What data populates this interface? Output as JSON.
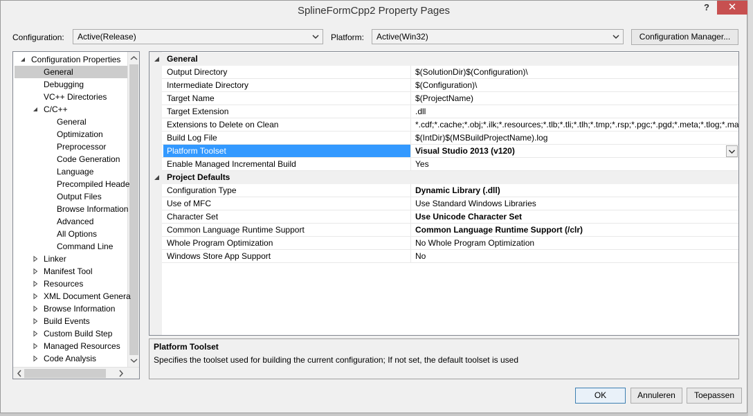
{
  "window": {
    "title": "SplineFormCpp2 Property Pages",
    "help": "?",
    "close": "✕"
  },
  "top": {
    "configuration_label": "Configuration:",
    "configuration_value": "Active(Release)",
    "platform_label": "Platform:",
    "platform_value": "Active(Win32)",
    "config_manager": "Configuration Manager..."
  },
  "tree": [
    {
      "label": "Configuration Properties",
      "level": 0,
      "toggle": "expanded"
    },
    {
      "label": "General",
      "level": 1,
      "selected": true
    },
    {
      "label": "Debugging",
      "level": 1
    },
    {
      "label": "VC++ Directories",
      "level": 1
    },
    {
      "label": "C/C++",
      "level": 1,
      "toggle": "expanded"
    },
    {
      "label": "General",
      "level": 2
    },
    {
      "label": "Optimization",
      "level": 2
    },
    {
      "label": "Preprocessor",
      "level": 2
    },
    {
      "label": "Code Generation",
      "level": 2
    },
    {
      "label": "Language",
      "level": 2
    },
    {
      "label": "Precompiled Heade",
      "level": 2
    },
    {
      "label": "Output Files",
      "level": 2
    },
    {
      "label": "Browse Information",
      "level": 2
    },
    {
      "label": "Advanced",
      "level": 2
    },
    {
      "label": "All Options",
      "level": 2
    },
    {
      "label": "Command Line",
      "level": 2
    },
    {
      "label": "Linker",
      "level": 1,
      "toggle": "collapsed"
    },
    {
      "label": "Manifest Tool",
      "level": 1,
      "toggle": "collapsed"
    },
    {
      "label": "Resources",
      "level": 1,
      "toggle": "collapsed"
    },
    {
      "label": "XML Document Genera",
      "level": 1,
      "toggle": "collapsed"
    },
    {
      "label": "Browse Information",
      "level": 1,
      "toggle": "collapsed"
    },
    {
      "label": "Build Events",
      "level": 1,
      "toggle": "collapsed"
    },
    {
      "label": "Custom Build Step",
      "level": 1,
      "toggle": "collapsed"
    },
    {
      "label": "Managed Resources",
      "level": 1,
      "toggle": "collapsed"
    },
    {
      "label": "Code Analysis",
      "level": 1,
      "toggle": "collapsed"
    }
  ],
  "grid": [
    {
      "category": "General"
    },
    {
      "name": "Output Directory",
      "value": "$(SolutionDir)$(Configuration)\\"
    },
    {
      "name": "Intermediate Directory",
      "value": "$(Configuration)\\"
    },
    {
      "name": "Target Name",
      "value": "$(ProjectName)"
    },
    {
      "name": "Target Extension",
      "value": ".dll"
    },
    {
      "name": "Extensions to Delete on Clean",
      "value": "*.cdf;*.cache;*.obj;*.ilk;*.resources;*.tlb;*.tli;*.tlh;*.tmp;*.rsp;*.pgc;*.pgd;*.meta;*.tlog;*.ma"
    },
    {
      "name": "Build Log File",
      "value": "$(IntDir)$(MSBuildProjectName).log"
    },
    {
      "name": "Platform Toolset",
      "value": "Visual Studio 2013 (v120)",
      "bold": true,
      "selected": true
    },
    {
      "name": "Enable Managed Incremental Build",
      "value": "Yes"
    },
    {
      "category": "Project Defaults"
    },
    {
      "name": "Configuration Type",
      "value": "Dynamic Library (.dll)",
      "bold": true
    },
    {
      "name": "Use of MFC",
      "value": "Use Standard Windows Libraries"
    },
    {
      "name": "Character Set",
      "value": "Use Unicode Character Set",
      "bold": true
    },
    {
      "name": "Common Language Runtime Support",
      "value": "Common Language Runtime Support (/clr)",
      "bold": true
    },
    {
      "name": "Whole Program Optimization",
      "value": "No Whole Program Optimization"
    },
    {
      "name": "Windows Store App Support",
      "value": "No"
    }
  ],
  "description": {
    "title": "Platform Toolset",
    "text": "Specifies the toolset used for building the current configuration; If not set, the default toolset is used"
  },
  "buttons": {
    "ok": "OK",
    "cancel": "Annuleren",
    "apply": "Toepassen"
  }
}
